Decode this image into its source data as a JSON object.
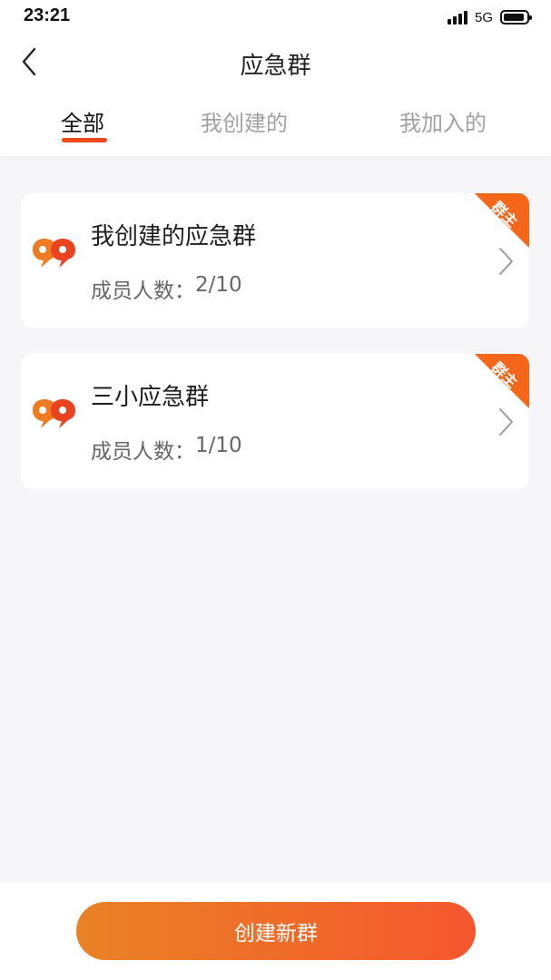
{
  "status_bar": {
    "time": "23:21",
    "network": "5G",
    "signal_icon": "signal-icon",
    "battery_icon": "battery-icon"
  },
  "header": {
    "title": "应急群",
    "back_icon": "chevron-left-icon"
  },
  "tabs": [
    {
      "label": "全部",
      "active": true
    },
    {
      "label": "我创建的",
      "active": false
    },
    {
      "label": "我加入的",
      "active": false
    }
  ],
  "groups": [
    {
      "name": "我创建的应急群",
      "members_label": "成员人数：",
      "members_value": "2/10",
      "badge": "群主"
    },
    {
      "name": "三小应急群",
      "members_label": "成员人数：",
      "members_value": "1/10",
      "badge": "群主"
    }
  ],
  "footer": {
    "create_label": "创建新群"
  },
  "colors": {
    "accent": "#ee4a1e",
    "button_gradient_start": "#e98225",
    "button_gradient_end": "#f5572e",
    "ribbon": "#f5661a",
    "group_icon": "#e9541f"
  }
}
